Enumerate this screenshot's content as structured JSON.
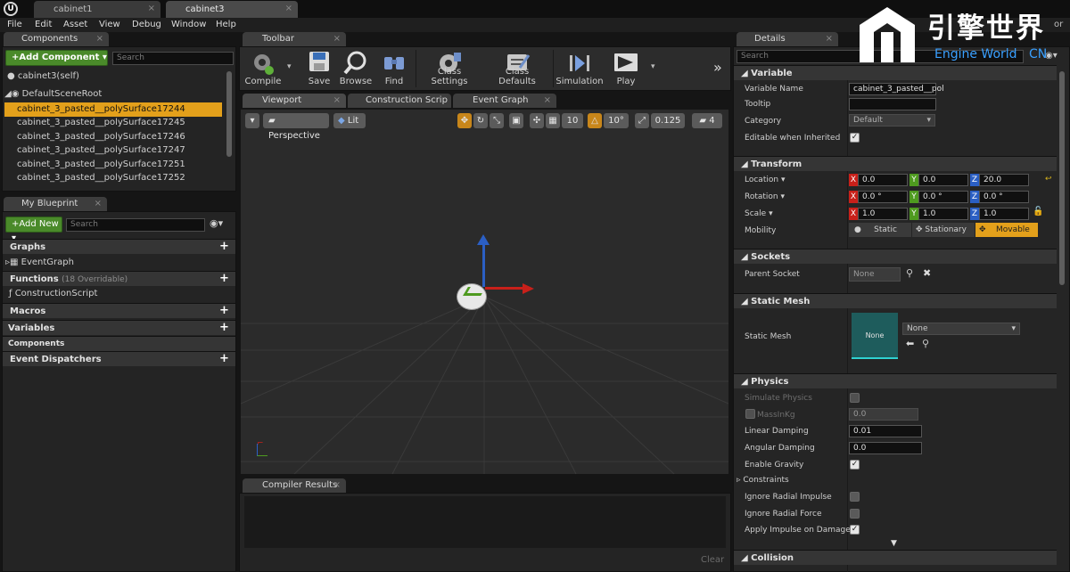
{
  "doc_tabs": [
    "cabinet1",
    "cabinet3"
  ],
  "watermark": {
    "title": "引擎世界",
    "subtitle": "Engine World",
    "cn": "CN",
    "editor_fragment": "or"
  },
  "menu": [
    "File",
    "Edit",
    "Asset",
    "View",
    "Debug",
    "Window",
    "Help"
  ],
  "components": {
    "tab": "Components",
    "add_label": "+Add Component",
    "search_placeholder": "Search",
    "self_label": "cabinet3(self)",
    "root_label": "DefaultSceneRoot",
    "items": [
      "cabinet_3_pasted__polySurface17244",
      "cabinet_3_pasted__polySurface17245",
      "cabinet_3_pasted__polySurface17246",
      "cabinet_3_pasted__polySurface17247",
      "cabinet_3_pasted__polySurface17251",
      "cabinet_3_pasted__polySurface17252"
    ],
    "selected_index": 0
  },
  "blueprint": {
    "tab": "My Blueprint",
    "add_label": "+Add New",
    "search_placeholder": "Search",
    "sections": {
      "graphs": "Graphs",
      "eventgraph": "EventGraph",
      "functions": "Functions",
      "functions_note": "(18 Overridable)",
      "construction": "ConstructionScript",
      "macros": "Macros",
      "variables": "Variables",
      "components": "Components",
      "dispatchers": "Event Dispatchers"
    }
  },
  "toolbar": {
    "tab": "Toolbar",
    "buttons": {
      "compile": "Compile",
      "save": "Save",
      "browse": "Browse",
      "find": "Find",
      "class_settings": "Class Settings",
      "class_defaults": "Class Defaults",
      "simulation": "Simulation",
      "play": "Play"
    }
  },
  "editor_tabs": {
    "viewport": "Viewport",
    "construction": "Construction Scrip",
    "eventgraph": "Event Graph"
  },
  "viewport": {
    "perspective": "Perspective",
    "lit": "Lit",
    "grid_snap": "10",
    "rot_snap": "10°",
    "scale_snap": "0.125",
    "camera_speed": "4"
  },
  "compiler": {
    "tab": "Compiler Results",
    "clear": "Clear"
  },
  "details": {
    "tab": "Details",
    "search_placeholder": "Search",
    "variable": {
      "header": "Variable",
      "name_label": "Variable Name",
      "name_value": "cabinet_3_pasted__pol",
      "tooltip_label": "Tooltip",
      "category_label": "Category",
      "category_value": "Default",
      "editable_label": "Editable when Inherited"
    },
    "transform": {
      "header": "Transform",
      "location_label": "Location",
      "rotation_label": "Rotation",
      "scale_label": "Scale",
      "mobility_label": "Mobility",
      "location": {
        "x": "0.0",
        "y": "0.0",
        "z": "20.0"
      },
      "rotation": {
        "x": "0.0 °",
        "y": "0.0 °",
        "z": "0.0 °"
      },
      "scale": {
        "x": "1.0",
        "y": "1.0",
        "z": "1.0"
      },
      "mobility": {
        "static": "Static",
        "stationary": "Stationary",
        "movable": "Movable"
      }
    },
    "sockets": {
      "header": "Sockets",
      "parent_label": "Parent Socket",
      "parent_value": "None"
    },
    "static_mesh": {
      "header": "Static Mesh",
      "label": "Static Mesh",
      "thumb": "None",
      "value": "None"
    },
    "physics": {
      "header": "Physics",
      "simulate": "Simulate Physics",
      "mass": "MassInKg",
      "mass_value": "0.0",
      "linear": "Linear Damping",
      "linear_value": "0.01",
      "angular": "Angular Damping",
      "angular_value": "0.0",
      "gravity": "Enable Gravity",
      "constraints": "Constraints",
      "radial_impulse": "Ignore Radial Impulse",
      "radial_force": "Ignore Radial Force",
      "apply_impulse": "Apply Impulse on Damage"
    },
    "collision": {
      "header": "Collision"
    }
  },
  "colors": {
    "accent": "#e3a01b",
    "green": "#4a8a2a",
    "axis_x": "#c8201a",
    "axis_y": "#4e9a1f",
    "axis_z": "#2b5fc4"
  }
}
